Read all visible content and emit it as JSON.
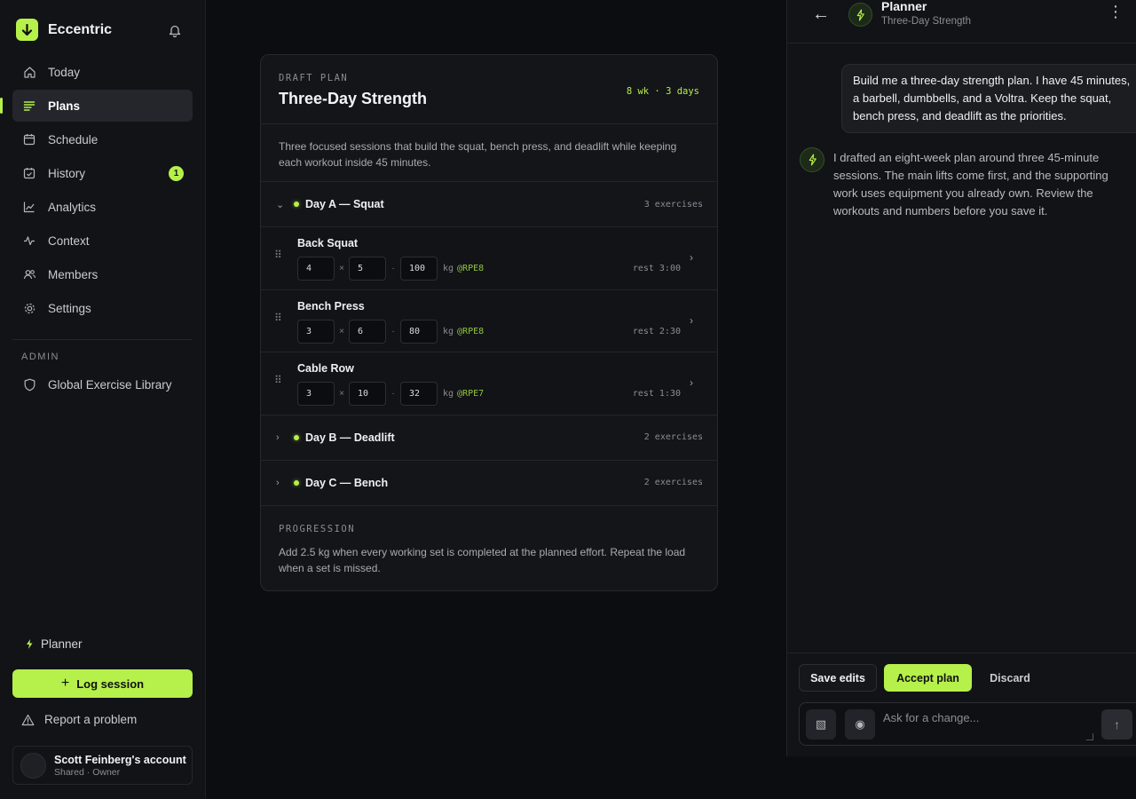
{
  "sidebar": {
    "brand": "Eccentric",
    "nav": [
      {
        "label": "Today",
        "icon": "home-icon"
      },
      {
        "label": "Plans",
        "icon": "list-icon",
        "active": true
      },
      {
        "label": "Schedule",
        "icon": "calendar-icon"
      },
      {
        "label": "History",
        "icon": "calendar-check-icon",
        "badge": "1"
      },
      {
        "label": "Analytics",
        "icon": "chart-line-icon"
      },
      {
        "label": "Context",
        "icon": "pulse-icon"
      },
      {
        "label": "Members",
        "icon": "users-icon"
      },
      {
        "label": "Settings",
        "icon": "gear-icon"
      }
    ],
    "admin_label": "ADMIN",
    "admin_item": "Global Exercise Library",
    "planner_link": "Planner",
    "log_session": "Log session",
    "report": "Report a problem",
    "account_name": "Scott Feinberg's account",
    "account_role": "Shared · Owner"
  },
  "plan": {
    "draft_label": "DRAFT PLAN",
    "title": "Three-Day Strength",
    "meta": "8 wk · 3 days",
    "description": "Three focused sessions that build the squat, bench press, and deadlift while keeping each workout inside 45 minutes.",
    "days": [
      {
        "name": "Day A — Squat",
        "count": "3 exercises",
        "expanded": true
      },
      {
        "name": "Day B — Deadlift",
        "count": "2 exercises",
        "expanded": false
      },
      {
        "name": "Day C — Bench",
        "count": "2 exercises",
        "expanded": false
      }
    ],
    "exercises": [
      {
        "name": "Back Squat",
        "sets": "4",
        "reps": "5",
        "load": "100",
        "unit": "kg",
        "rpe": "@RPE8",
        "rest": "rest 3:00"
      },
      {
        "name": "Bench Press",
        "sets": "3",
        "reps": "6",
        "load": "80",
        "unit": "kg",
        "rpe": "@RPE8",
        "rest": "rest 2:30"
      },
      {
        "name": "Cable Row",
        "sets": "3",
        "reps": "10",
        "load": "32",
        "unit": "kg",
        "rpe": "@RPE7",
        "rest": "rest 1:30"
      }
    ],
    "times_symbol": "×",
    "dot_symbol": "·",
    "progression_label": "PROGRESSION",
    "progression_text": "Add 2.5 kg when every working set is completed at the planned effort. Repeat the load when a set is missed."
  },
  "chat": {
    "title": "Planner",
    "subtitle": "Three-Day Strength",
    "user_message": "Build me a three-day strength plan. I have 45 minutes, a barbell, dumbbells, and a Voltra. Keep the squat, bench press, and deadlift as the priorities.",
    "bot_message": "I drafted an eight-week plan around three 45-minute sessions. The main lifts come first, and the supporting work uses equipment you already own. Review the workouts and numbers before you save it.",
    "save_edits": "Save edits",
    "accept_plan": "Accept plan",
    "discard": "Discard",
    "input_placeholder": "Ask for a change..."
  },
  "colors": {
    "accent": "#b6f04a",
    "background": "#0c0d10",
    "panel": "#121317"
  }
}
